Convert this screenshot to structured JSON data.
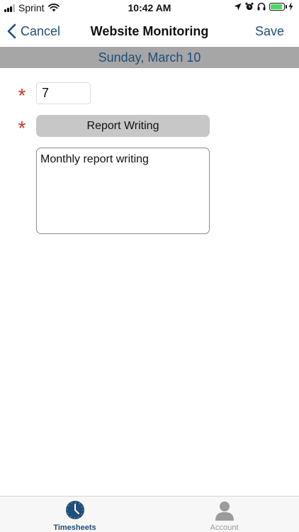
{
  "status_bar": {
    "carrier": "Sprint",
    "time": "10:42 AM",
    "battery_level": 0.9
  },
  "nav": {
    "back_label": "Cancel",
    "title": "Website Monitoring",
    "save_label": "Save"
  },
  "date_header": "Sunday, March 10",
  "form": {
    "hours_value": "7",
    "task_label": "Report Writing",
    "notes_value": "Monthly report writing",
    "required_marker": "*"
  },
  "tabs": [
    {
      "label": "Timesheets",
      "icon": "clock-icon",
      "selected": true
    },
    {
      "label": "Account",
      "icon": "person-icon",
      "selected": false
    }
  ],
  "colors": {
    "accent": "#1f4e79",
    "required": "#c0392b",
    "header_gray": "#a6a6a6",
    "battery": "#4cd964",
    "inactive_tab": "#9b9b9b"
  }
}
